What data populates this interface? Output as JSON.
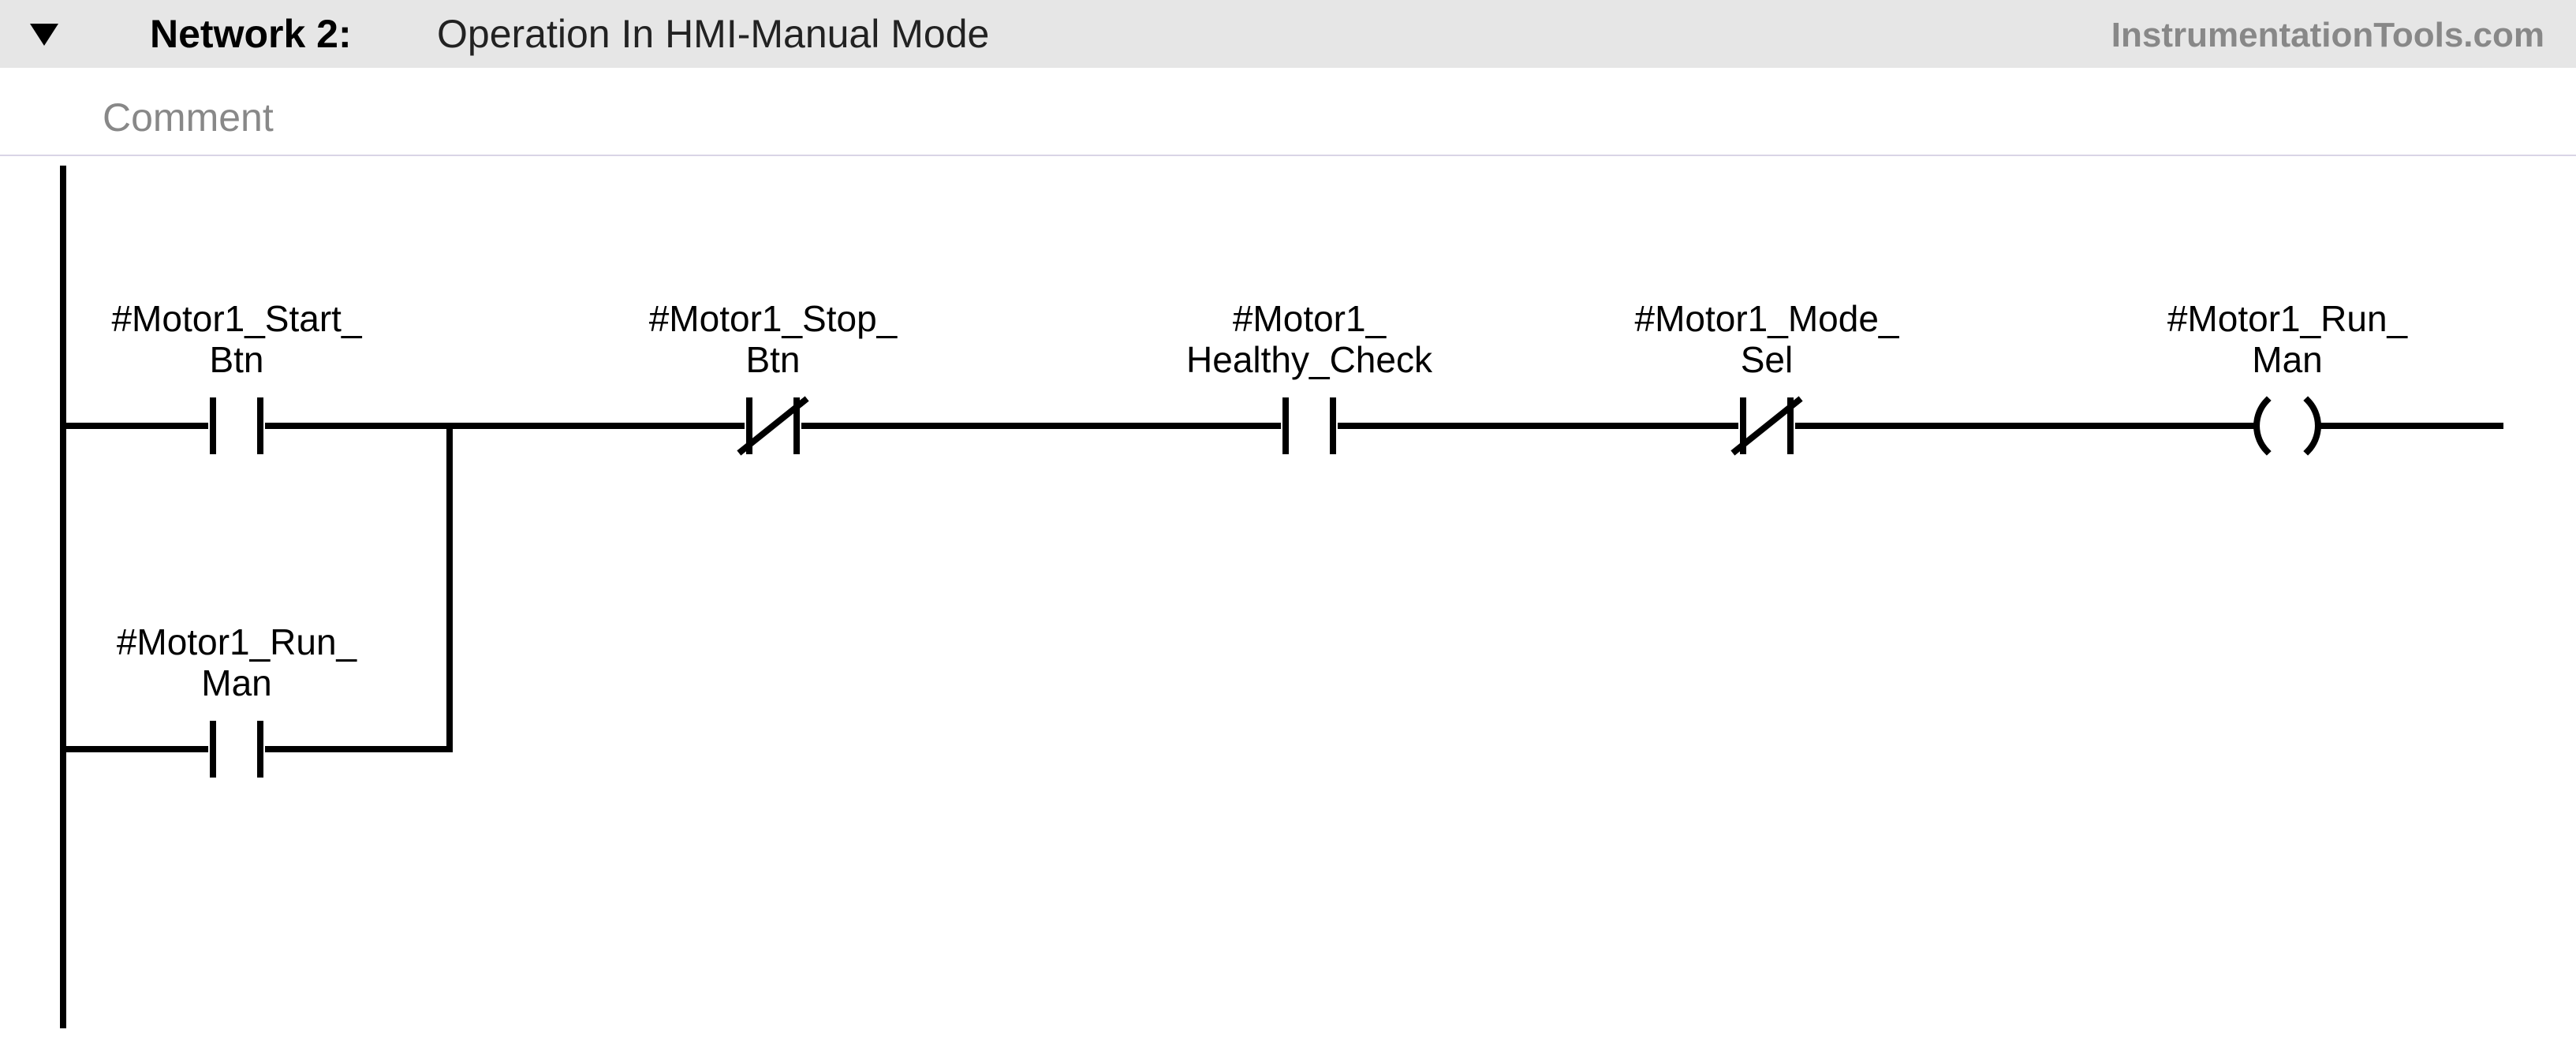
{
  "header": {
    "network_label": "Network 2:",
    "title": "Operation In HMI-Manual Mode",
    "watermark": "InstrumentationTools.com"
  },
  "comment_placeholder": "Comment",
  "rung": {
    "top_elements": [
      {
        "tag_line1": "#Motor1_Start_",
        "tag_line2": "Btn",
        "type": "NO"
      },
      {
        "tag_line1": "#Motor1_Stop_",
        "tag_line2": "Btn",
        "type": "NC"
      },
      {
        "tag_line1": "#Motor1_",
        "tag_line2": "Healthy_Check",
        "type": "NO"
      },
      {
        "tag_line1": "#Motor1_Mode_",
        "tag_line2": "Sel",
        "type": "NC"
      },
      {
        "tag_line1": "#Motor1_Run_",
        "tag_line2": "Man",
        "type": "COIL"
      }
    ],
    "branch_element": {
      "tag_line1": "#Motor1_Run_",
      "tag_line2": "Man",
      "type": "NO"
    }
  }
}
